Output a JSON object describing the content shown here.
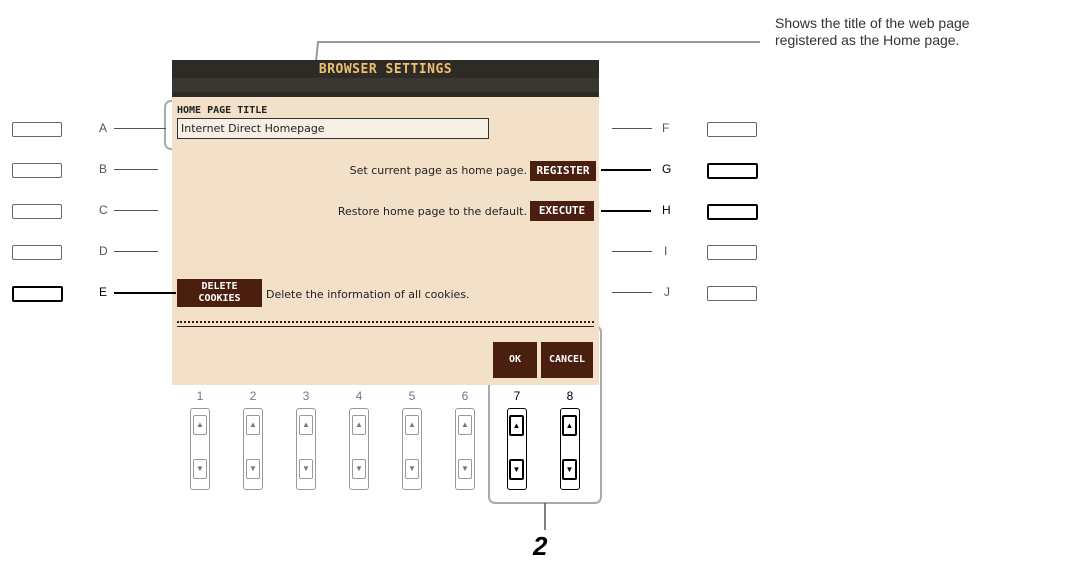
{
  "callout": {
    "text_line1": "Shows the title of the web page",
    "text_line2": "registered as the Home page."
  },
  "screen": {
    "title": "BROWSER SETTINGS",
    "home_title_label": "HOME PAGE TITLE",
    "home_title_value": "Internet Direct Homepage",
    "register_text": "Set current page as home page.",
    "register_button": "REGISTER",
    "execute_text": "Restore home page to the default.",
    "execute_button": "EXECUTE",
    "delete_button_line1": "DELETE",
    "delete_button_line2": "COOKIES",
    "delete_text": "Delete the information of all cookies.",
    "ok_button": "OK",
    "cancel_button": "CANCEL"
  },
  "left_buttons": [
    "A",
    "B",
    "C",
    "D",
    "E"
  ],
  "right_buttons": [
    "F",
    "G",
    "H",
    "I",
    "J"
  ],
  "bottom_numbers": [
    "1",
    "2",
    "3",
    "4",
    "5",
    "6",
    "7",
    "8"
  ],
  "arrows": {
    "up": "▲",
    "down": "▼"
  },
  "step_marker": "2"
}
